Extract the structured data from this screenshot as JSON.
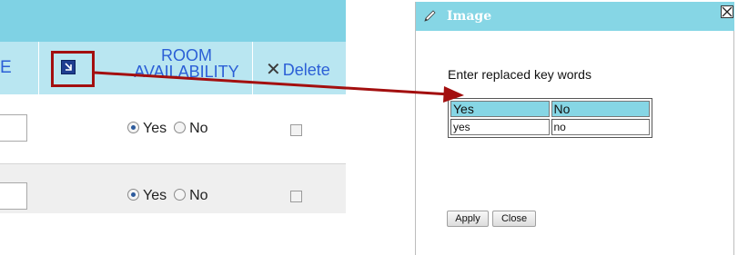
{
  "table": {
    "truncated_header": "E",
    "room_header_line1": "ROOM",
    "room_header_line2": "AVAILABILITY",
    "delete_icon": "x-icon",
    "delete_label": "Delete",
    "expand_icon": "expand-arrow-icon",
    "rows": [
      {
        "yes": "Yes",
        "no": "No",
        "selected": "Yes"
      },
      {
        "yes": "Yes",
        "no": "No",
        "selected": "Yes"
      }
    ]
  },
  "dialog": {
    "title_icon": "pencil-icon",
    "title": "Image",
    "close_icon": "close-icon",
    "prompt": "Enter replaced key words",
    "columns": [
      "Yes",
      "No"
    ],
    "values": [
      "yes",
      "no"
    ],
    "apply_label": "Apply",
    "close_label": "Close"
  },
  "colors": {
    "header_bg": "#b9e6f1",
    "topbar_bg": "#7fd2e4",
    "dialog_title_bg": "#86d6e5",
    "link_blue": "#2b5fd6",
    "highlight_red": "#a30f0f"
  }
}
